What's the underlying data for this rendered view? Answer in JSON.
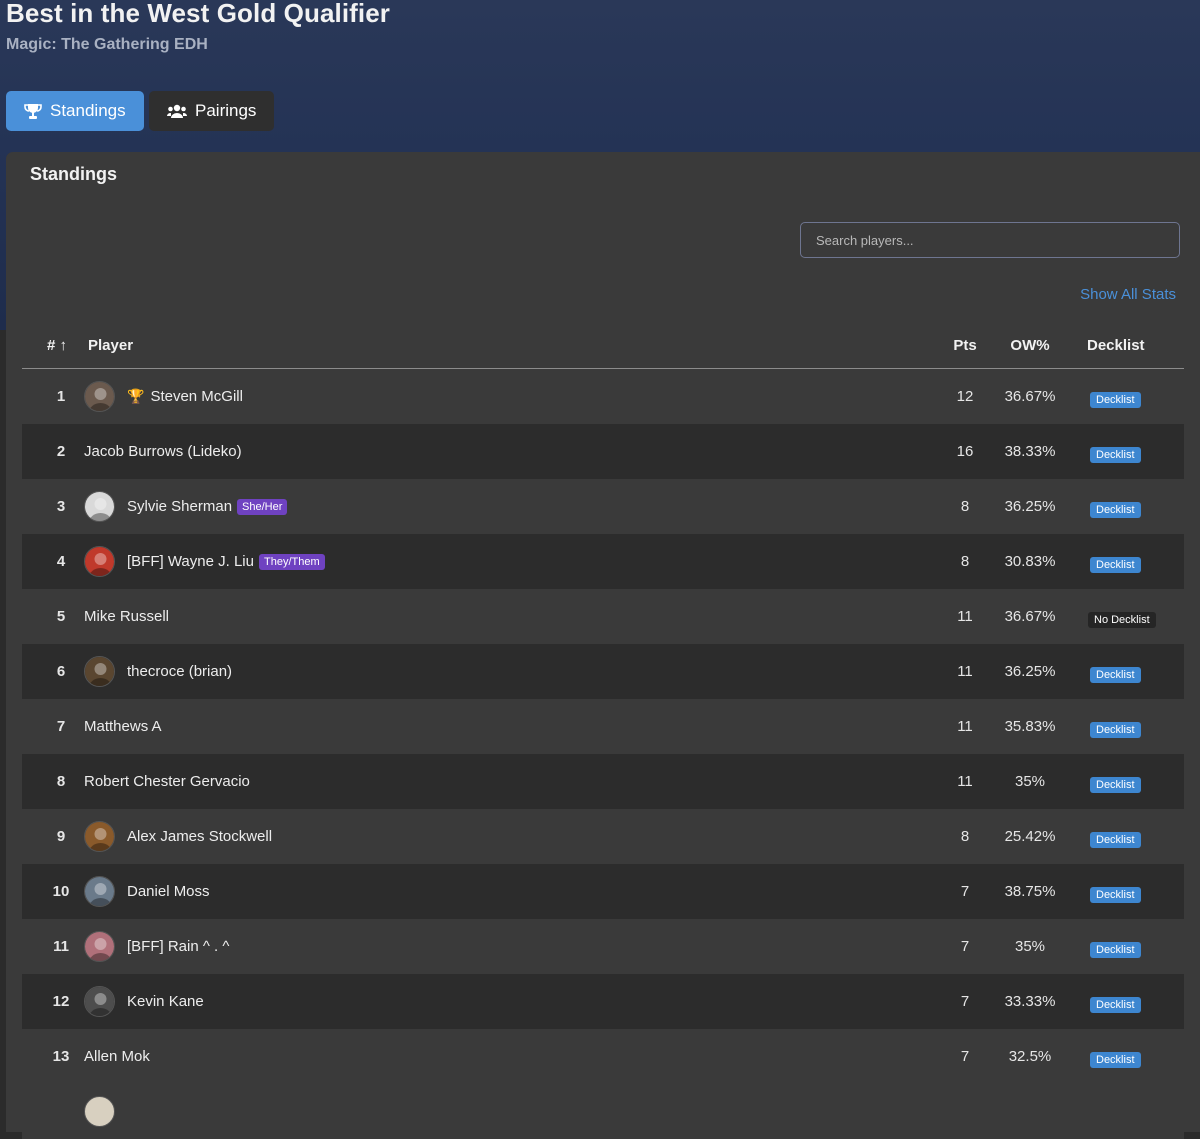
{
  "header": {
    "title": "Best in the West Gold Qualifier",
    "subtitle": "Magic: The Gathering EDH"
  },
  "tabs": [
    {
      "label": "Standings",
      "icon": "trophy-icon",
      "active": true
    },
    {
      "label": "Pairings",
      "icon": "users-icon",
      "active": false
    }
  ],
  "standings": {
    "title": "Standings",
    "search_placeholder": "Search players...",
    "show_all_stats": "Show All Stats",
    "columns": {
      "rank": "# ↑",
      "player": "Player",
      "pts": "Pts",
      "ow": "OW%",
      "decklist": "Decklist"
    },
    "rows": [
      {
        "rank": "1",
        "name": "Steven McGill",
        "avatar": true,
        "winner": true,
        "pronoun": "",
        "pts": "12",
        "ow": "36.67%",
        "decklist": "Decklist",
        "has_deck": true
      },
      {
        "rank": "2",
        "name": "Jacob Burrows (Lideko)",
        "avatar": false,
        "winner": false,
        "pronoun": "",
        "pts": "16",
        "ow": "38.33%",
        "decklist": "Decklist",
        "has_deck": true
      },
      {
        "rank": "3",
        "name": "Sylvie Sherman",
        "avatar": true,
        "winner": false,
        "pronoun": "She/Her",
        "pts": "8",
        "ow": "36.25%",
        "decklist": "Decklist",
        "has_deck": true
      },
      {
        "rank": "4",
        "name": "[BFF] Wayne J. Liu",
        "avatar": true,
        "winner": false,
        "pronoun": "They/Them",
        "pts": "8",
        "ow": "30.83%",
        "decklist": "Decklist",
        "has_deck": true
      },
      {
        "rank": "5",
        "name": "Mike Russell",
        "avatar": false,
        "winner": false,
        "pronoun": "",
        "pts": "11",
        "ow": "36.67%",
        "decklist": "No Decklist",
        "has_deck": false
      },
      {
        "rank": "6",
        "name": "thecroce (brian)",
        "avatar": true,
        "winner": false,
        "pronoun": "",
        "pts": "11",
        "ow": "36.25%",
        "decklist": "Decklist",
        "has_deck": true
      },
      {
        "rank": "7",
        "name": "Matthews A",
        "avatar": false,
        "winner": false,
        "pronoun": "",
        "pts": "11",
        "ow": "35.83%",
        "decklist": "Decklist",
        "has_deck": true
      },
      {
        "rank": "8",
        "name": "Robert Chester Gervacio",
        "avatar": false,
        "winner": false,
        "pronoun": "",
        "pts": "11",
        "ow": "35%",
        "decklist": "Decklist",
        "has_deck": true
      },
      {
        "rank": "9",
        "name": "Alex James Stockwell",
        "avatar": true,
        "winner": false,
        "pronoun": "",
        "pts": "8",
        "ow": "25.42%",
        "decklist": "Decklist",
        "has_deck": true
      },
      {
        "rank": "10",
        "name": "Daniel Moss",
        "avatar": true,
        "winner": false,
        "pronoun": "",
        "pts": "7",
        "ow": "38.75%",
        "decklist": "Decklist",
        "has_deck": true
      },
      {
        "rank": "11",
        "name": "[BFF] Rain ^ . ^",
        "avatar": true,
        "winner": false,
        "pronoun": "",
        "pts": "7",
        "ow": "35%",
        "decklist": "Decklist",
        "has_deck": true
      },
      {
        "rank": "12",
        "name": "Kevin Kane",
        "avatar": true,
        "winner": false,
        "pronoun": "",
        "pts": "7",
        "ow": "33.33%",
        "decklist": "Decklist",
        "has_deck": true
      },
      {
        "rank": "13",
        "name": "Allen Mok",
        "avatar": false,
        "winner": false,
        "pronoun": "",
        "pts": "7",
        "ow": "32.5%",
        "decklist": "Decklist",
        "has_deck": true
      }
    ]
  },
  "colors": {
    "accent": "#4a90d9",
    "pronoun": "#6f42c1",
    "trophy": "#f0b429"
  }
}
